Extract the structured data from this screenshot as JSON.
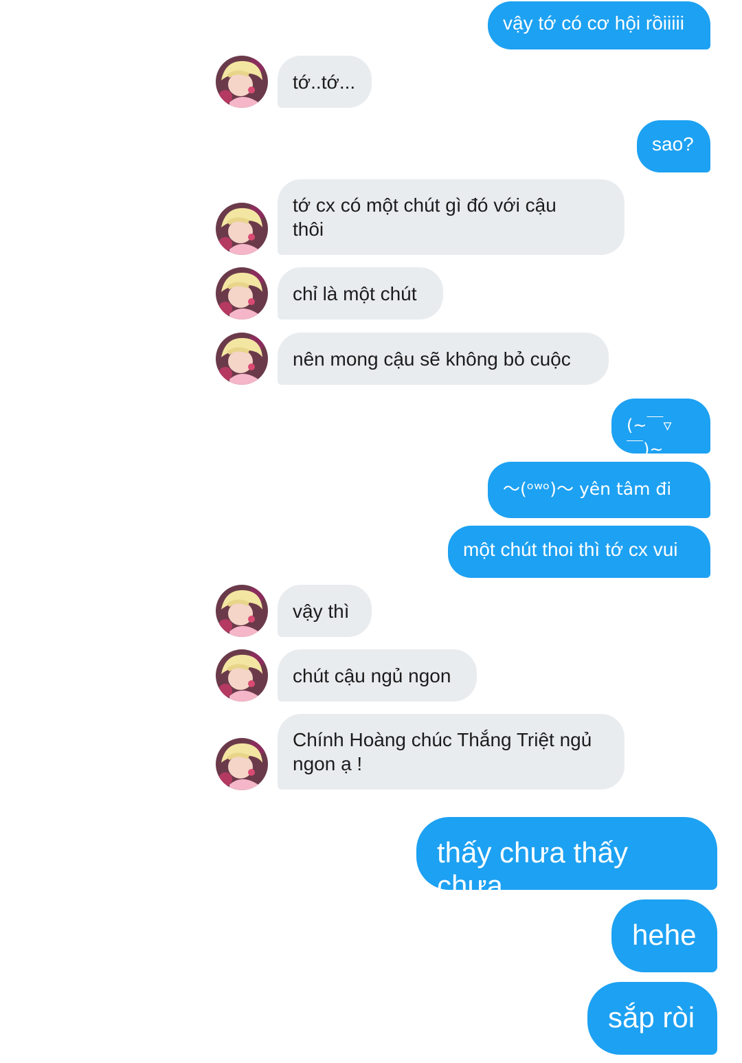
{
  "messages": [
    {
      "from": "me",
      "text": "vậy tớ có cơ hội rồiiiii"
    },
    {
      "from": "them",
      "text": "tớ..tớ..."
    },
    {
      "from": "me",
      "text": "sao?"
    },
    {
      "from": "them",
      "text": "tớ cx có một chút gì đó với cậu\nthôi"
    },
    {
      "from": "them",
      "text": "chỉ là một chút"
    },
    {
      "from": "them",
      "text": "nên mong cậu sẽ không bỏ cuộc"
    },
    {
      "from": "me",
      "text": "(~￣▿￣)~"
    },
    {
      "from": "me",
      "text": "〜(ᵒʷᵒ)〜 yên tâm đi"
    },
    {
      "from": "me",
      "text": "một chút thoi thì tớ cx vui"
    },
    {
      "from": "them",
      "text": "vậy thì"
    },
    {
      "from": "them",
      "text": "chút cậu ngủ ngon"
    },
    {
      "from": "them",
      "text": "Chính Hoàng chúc Thắng Triệt ngủ\nngon ạ !"
    },
    {
      "from": "me",
      "text": "thấy chưa thấy chưa"
    },
    {
      "from": "me",
      "text": "hehe"
    },
    {
      "from": "me",
      "text": "sắp ròi"
    }
  ],
  "colors": {
    "sent_bubble": "#1da1f2",
    "received_bubble": "#e9ecef",
    "sent_text": "#ffffff",
    "received_text": "#1c1c1c"
  },
  "icons": {
    "avatar": "contact-avatar-icon"
  }
}
